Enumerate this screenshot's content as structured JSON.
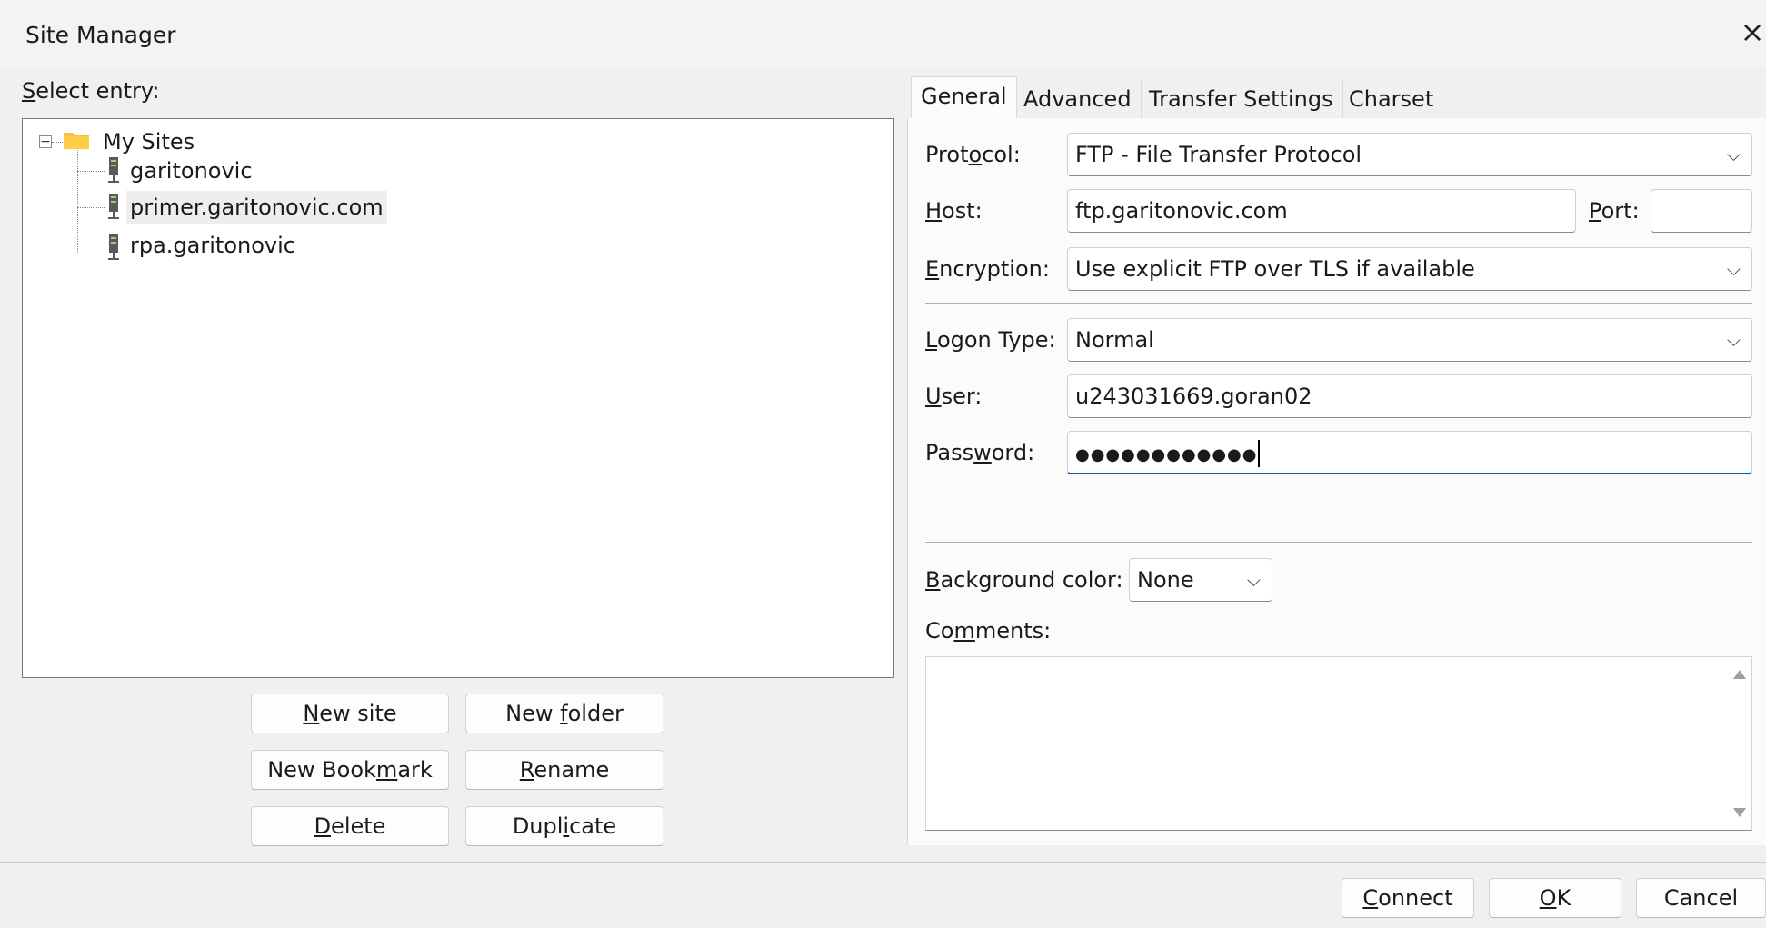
{
  "window": {
    "title": "Site Manager",
    "close_glyph": "×"
  },
  "tree": {
    "label_prefix": "S",
    "label_rest": "elect entry:",
    "root": {
      "label": "My Sites",
      "expander": "−"
    },
    "sites": [
      {
        "label": "garitonovic",
        "selected": false
      },
      {
        "label": "primer.garitonovic.com",
        "selected": true
      },
      {
        "label": "rpa.garitonovic",
        "selected": false
      }
    ]
  },
  "buttons": {
    "new_site": {
      "u": "N",
      "rest": "ew site"
    },
    "new_folder": {
      "pre": "New ",
      "u": "f",
      "rest": "older"
    },
    "new_bookmark": {
      "pre": "New Book",
      "u": "m",
      "rest": "ark"
    },
    "rename": {
      "u": "R",
      "rest": "ename"
    },
    "delete": {
      "u": "D",
      "rest": "elete"
    },
    "duplicate": {
      "pre": "Dupl",
      "u": "i",
      "rest": "cate"
    }
  },
  "tabs": [
    "General",
    "Advanced",
    "Transfer Settings",
    "Charset"
  ],
  "general": {
    "protocol": {
      "pre": "Prot",
      "u": "o",
      "rest": "col:",
      "value": "FTP - File Transfer Protocol"
    },
    "host": {
      "u": "H",
      "rest": "ost:",
      "value": "ftp.garitonovic.com"
    },
    "port": {
      "u": "P",
      "rest": "ort:",
      "value": ""
    },
    "encryption": {
      "u": "E",
      "rest": "ncryption:",
      "value": "Use explicit FTP over TLS if available"
    },
    "logon_type": {
      "u": "L",
      "rest": "ogon Type:",
      "value": "Normal"
    },
    "user": {
      "u": "U",
      "rest": "ser:",
      "value": "u243031669.goran02"
    },
    "password": {
      "pre": "Pass",
      "u": "w",
      "rest": "ord:",
      "value": "●●●●●●●●●●●●"
    },
    "background_color": {
      "u": "B",
      "rest": "ackground color:",
      "value": "None"
    },
    "comments": {
      "pre": "Co",
      "u": "m",
      "rest": "ments:",
      "value": ""
    }
  },
  "footer": {
    "connect": {
      "u": "C",
      "rest": "onnect"
    },
    "ok": {
      "u": "O",
      "rest": "K"
    },
    "cancel": "Cancel"
  },
  "icons": {
    "chevron": "⌵",
    "close": "close-icon",
    "folder": "folder-icon",
    "server": "server-icon"
  },
  "colors": {
    "focus_accent": "#005fb8",
    "folder": "#f5c242"
  }
}
